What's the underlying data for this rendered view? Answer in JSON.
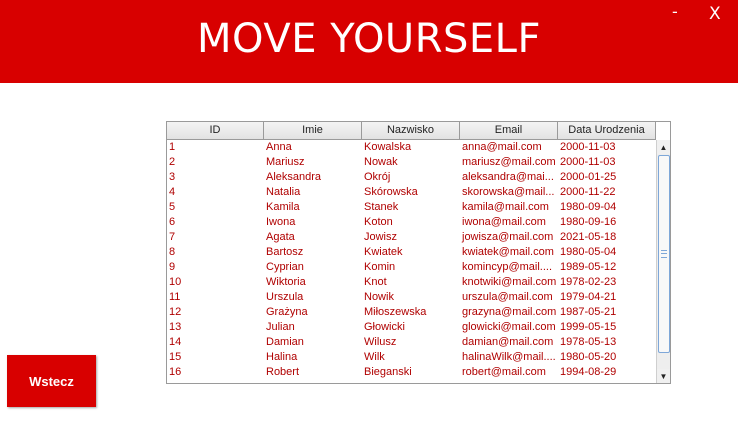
{
  "header": {
    "title": "MOVE YOURSELF",
    "minimize": "-",
    "close": "X"
  },
  "table": {
    "columns": [
      "ID",
      "Imie",
      "Nazwisko",
      "Email",
      "Data Urodzenia"
    ],
    "rows": [
      [
        "1",
        "Anna",
        "Kowalska",
        "anna@mail.com",
        "2000-11-03"
      ],
      [
        "2",
        "Mariusz",
        "Nowak",
        "mariusz@mail.com",
        "2000-11-03"
      ],
      [
        "3",
        "Aleksandra",
        "Okrój",
        "aleksandra@mai...",
        "2000-01-25"
      ],
      [
        "4",
        "Natalia",
        "Skórowska",
        "skorowska@mail...",
        "2000-11-22"
      ],
      [
        "5",
        "Kamila",
        "Stanek",
        "kamila@mail.com",
        "1980-09-04"
      ],
      [
        "6",
        "Iwona",
        "Koton",
        "iwona@mail.com",
        "1980-09-16"
      ],
      [
        "7",
        "Agata",
        "Jowisz",
        "jowisza@mail.com",
        "2021-05-18"
      ],
      [
        "8",
        "Bartosz",
        "Kwiatek",
        "kwiatek@mail.com",
        "1980-05-04"
      ],
      [
        "9",
        "Cyprian",
        "Komin",
        "komincyp@mail....",
        "1989-05-12"
      ],
      [
        "10",
        "Wiktoria",
        "Knot",
        "knotwiki@mail.com",
        "1978-02-23"
      ],
      [
        "11",
        "Urszula",
        "Nowik",
        "urszula@mail.com",
        "1979-04-21"
      ],
      [
        "12",
        "Grażyna",
        "Miłoszewska",
        "grazyna@mail.com",
        "1987-05-21"
      ],
      [
        "13",
        "Julian",
        "Głowicki",
        "glowicki@mail.com",
        "1999-05-15"
      ],
      [
        "14",
        "Damian",
        "Wilusz",
        "damian@mail.com",
        "1978-05-13"
      ],
      [
        "15",
        "Halina",
        "Wilk",
        "halinaWilk@mail....",
        "1980-05-20"
      ],
      [
        "16",
        "Robert",
        "Bieganski",
        "robert@mail.com",
        "1994-08-29"
      ]
    ]
  },
  "scroll": {
    "up_glyph": "▲",
    "down_glyph": "▼"
  },
  "back_button": {
    "label": "Wstecz"
  },
  "colors": {
    "accent": "#d80000",
    "cell_text": "#b00000"
  }
}
